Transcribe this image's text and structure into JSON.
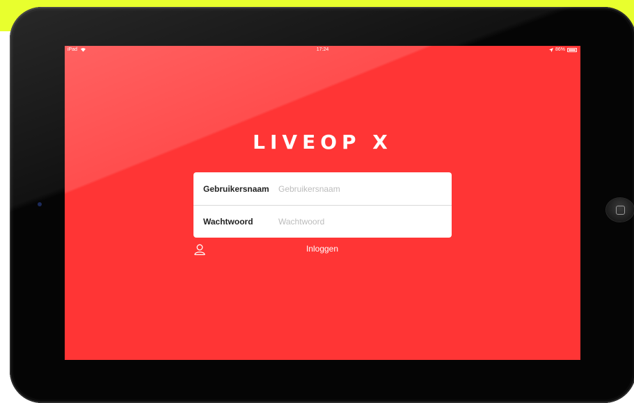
{
  "status_bar": {
    "device": "iPad",
    "time": "17:24",
    "battery": "86%"
  },
  "app": {
    "logo_text": "LIVEOP X"
  },
  "login_form": {
    "username_label": "Gebruikersnaam",
    "username_placeholder": "Gebruikersnaam",
    "password_label": "Wachtwoord",
    "password_placeholder": "Wachtwoord",
    "login_button": "Inloggen"
  },
  "icons": {
    "wifi": "wifi-icon",
    "location": "location-arrow-icon",
    "battery": "battery-icon",
    "user": "user-icon",
    "home": "home-button-icon"
  },
  "colors": {
    "screen_background": "#ff3535",
    "top_banner": "#e8ff2e",
    "device_body": "#050505"
  }
}
